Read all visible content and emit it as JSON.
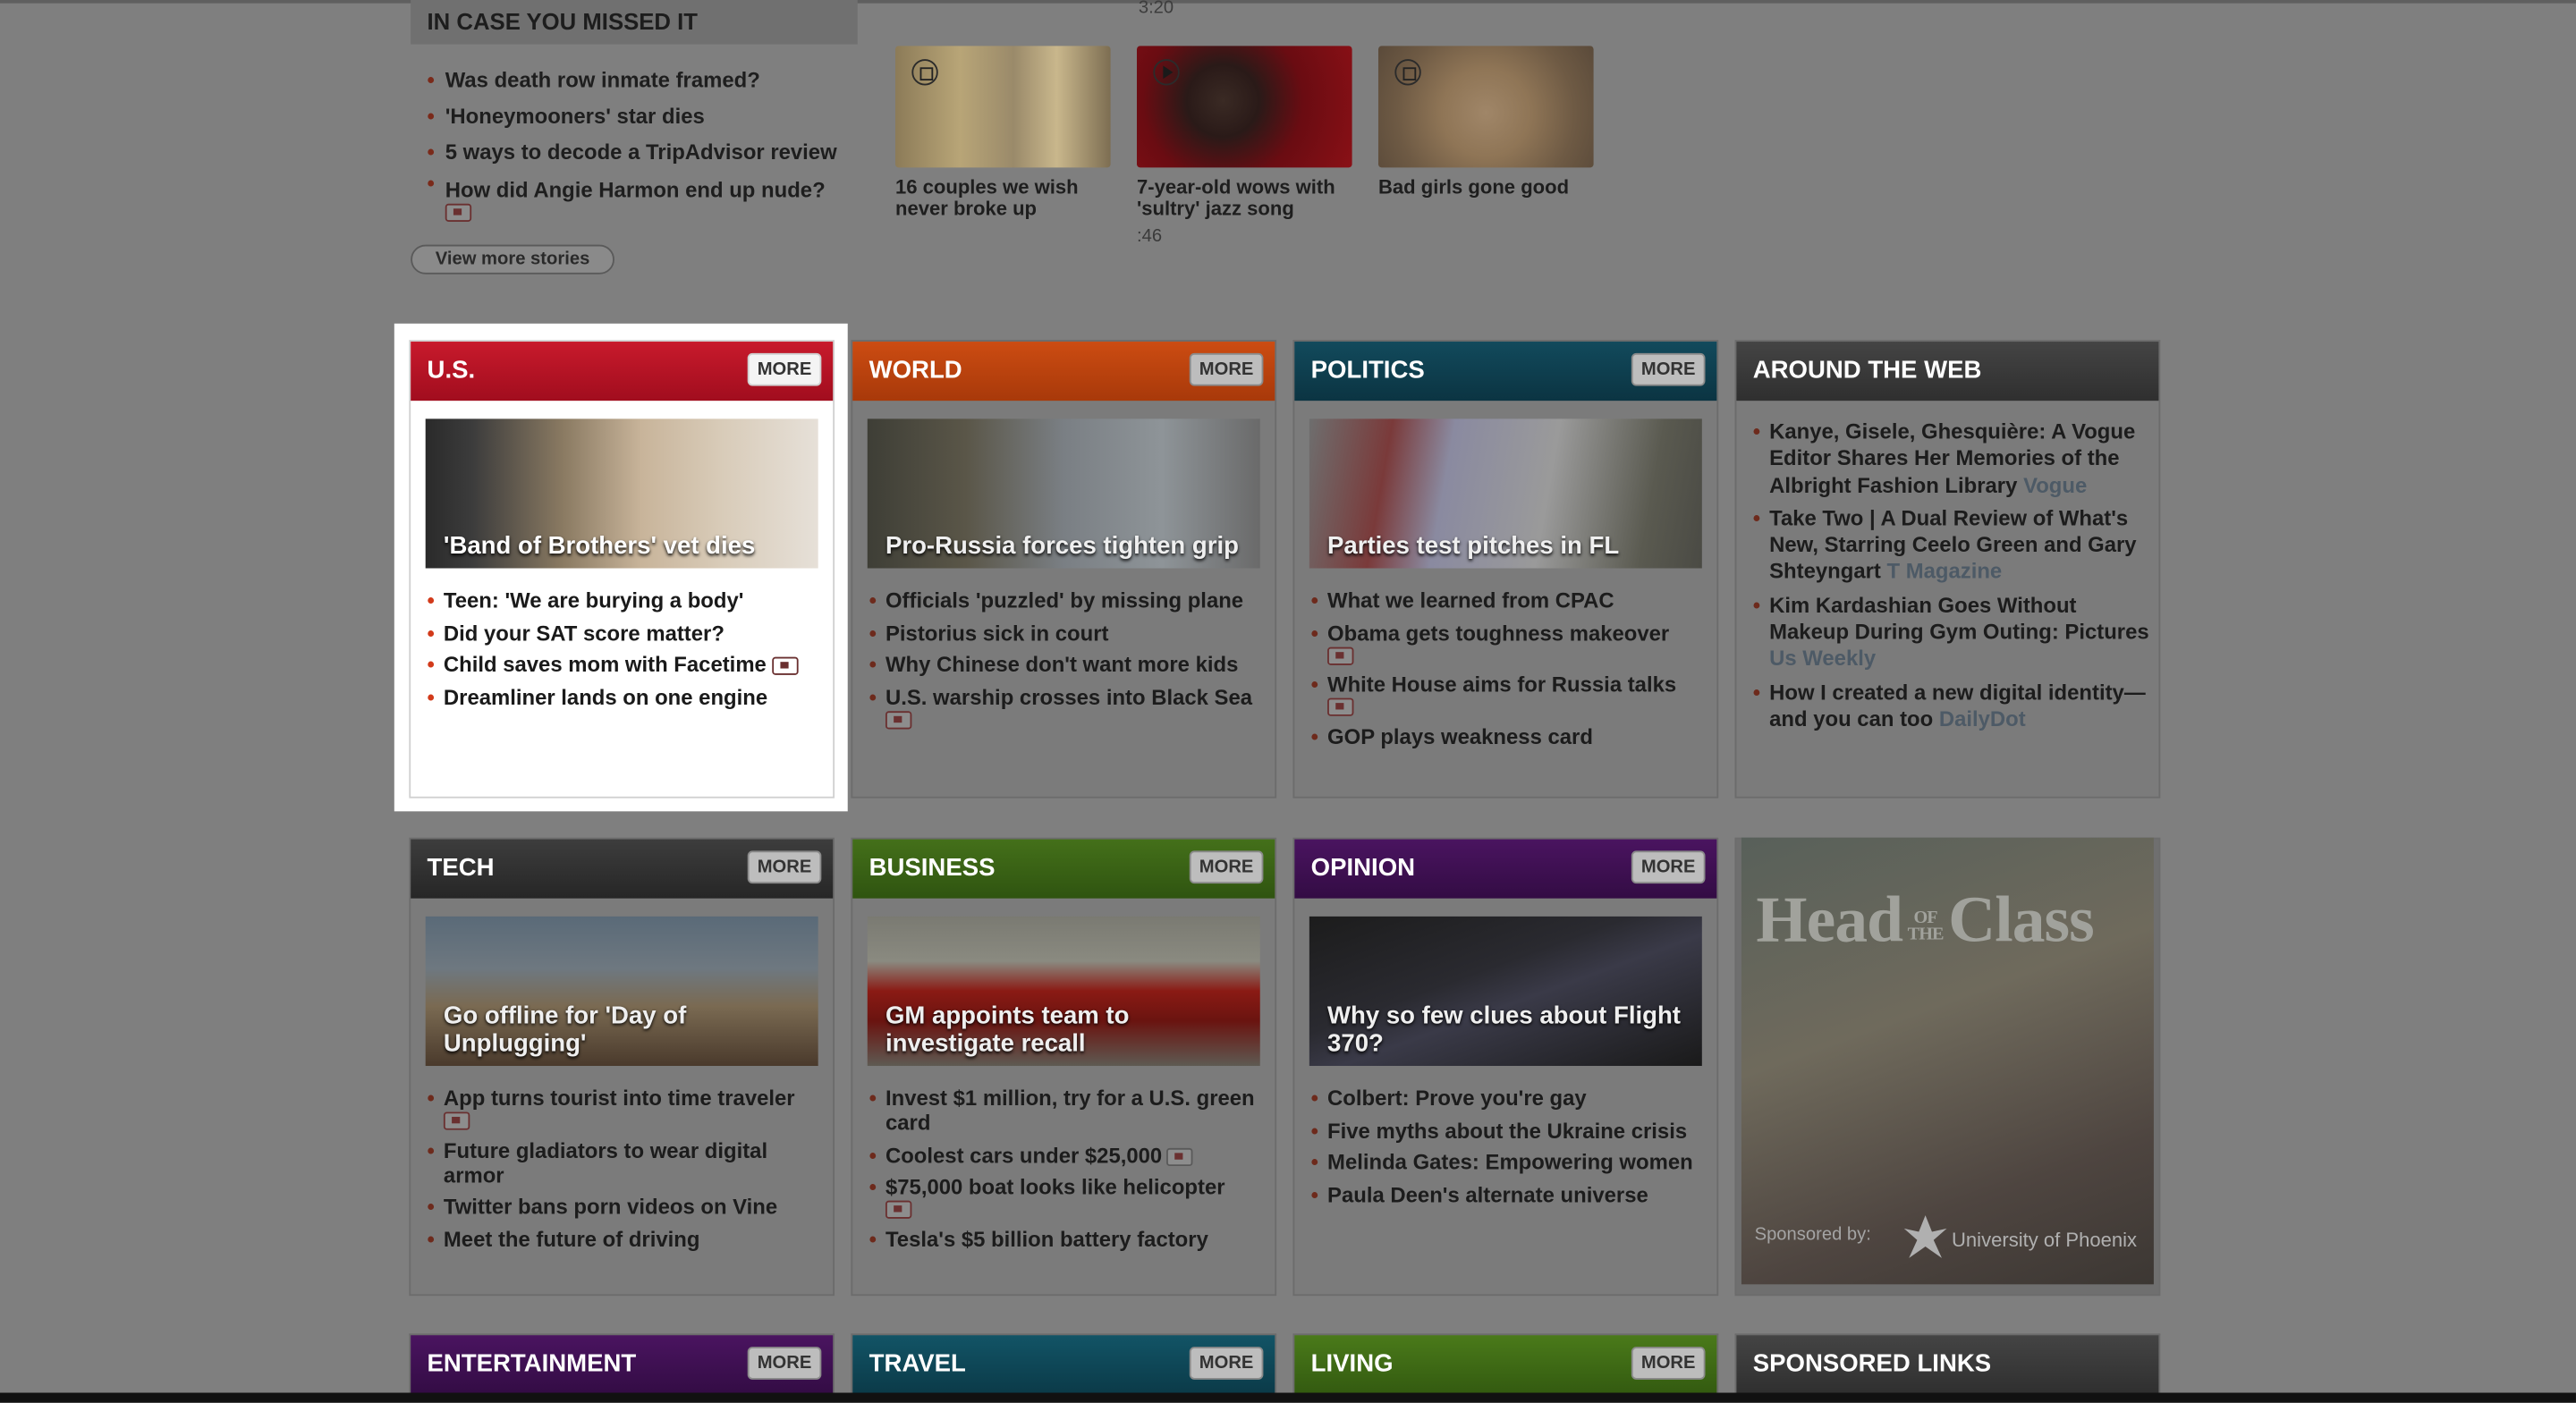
{
  "colors": {
    "us": "#b40f22",
    "world": "#c1440c",
    "politics": "#0f4050",
    "around_web": "#3a3a3a",
    "tech": "#333333",
    "business": "#3a5f12",
    "opinion": "#3d1250",
    "entertainment": "#3d1250",
    "travel": "#0f4656",
    "living": "#3e6512",
    "sponsored": "#3a3a3a"
  },
  "icymi": {
    "title": "IN CASE YOU MISSED IT",
    "items": [
      {
        "text": "Was death row inmate framed?"
      },
      {
        "text": "'Honeymooners' star dies"
      },
      {
        "text": "5 ways to decode a TripAdvisor review"
      },
      {
        "text": "How did Angie Harmon end up nude?",
        "icon": "video-icon"
      }
    ],
    "view_more": "View more stories",
    "top_time": "3:20",
    "thumbs": [
      {
        "caption": "16 couples we wish never broke up",
        "icon": "gallery-icon"
      },
      {
        "caption": "7-year-old wows with 'sultry' jazz song",
        "icon": "play-icon",
        "time": ":46"
      },
      {
        "caption": "Bad girls gone good",
        "icon": "gallery-icon"
      }
    ]
  },
  "more_label": "MORE",
  "sections": {
    "us": {
      "title": "U.S.",
      "image_caption": "'Band of Brothers' vet dies",
      "items": [
        "Teen: 'We are burying a body'",
        "Did your SAT score matter?",
        "Child saves mom with Facetime",
        "Dreamliner lands on one engine"
      ]
    },
    "world": {
      "title": "WORLD",
      "image_caption": "Pro-Russia forces tighten grip",
      "items": [
        "Officials 'puzzled' by missing plane",
        "Pistorius sick in court",
        "Why Chinese don't want more kids",
        "U.S. warship crosses into Black Sea"
      ]
    },
    "politics": {
      "title": "POLITICS",
      "image_caption": "Parties test pitches in FL",
      "items": [
        "What we learned from CPAC",
        "Obama gets toughness makeover",
        "White House aims for Russia talks",
        "GOP plays weakness card"
      ]
    },
    "around_web": {
      "title": "AROUND THE WEB",
      "items": [
        {
          "text": "Kanye, Gisele, Ghesquière: A Vogue Editor Shares Her Memories of the Albright Fashion Library",
          "source": "Vogue"
        },
        {
          "text": "Take Two | A Dual Review of What's New, Starring Ceelo Green and Gary Shteyngart",
          "source": "T Magazine"
        },
        {
          "text": "Kim Kardashian Goes Without Makeup During Gym Outing: Pictures",
          "source": "Us Weekly"
        },
        {
          "text": "How I created a new digital identity—and you can too",
          "source": "DailyDot"
        }
      ]
    },
    "tech": {
      "title": "TECH",
      "image_caption": "Go offline for 'Day of Unplugging'",
      "items": [
        "App turns tourist into time traveler",
        "Future gladiators to wear digital armor",
        "Twitter bans porn videos on Vine",
        "Meet the future of driving"
      ]
    },
    "business": {
      "title": "BUSINESS",
      "image_caption": "GM appoints team to investigate recall",
      "items": [
        "Invest $1 million, try for a U.S. green card",
        "Coolest cars under $25,000",
        "$75,000 boat looks like helicopter",
        "Tesla's $5 billion battery factory"
      ]
    },
    "opinion": {
      "title": "OPINION",
      "image_caption": "Why so few clues about Flight 370?",
      "items": [
        "Colbert: Prove you're gay",
        "Five myths about the Ukraine crisis",
        "Melinda Gates: Empowering women",
        "Paula Deen's alternate universe"
      ]
    },
    "entertainment": {
      "title": "ENTERTAINMENT"
    },
    "travel": {
      "title": "TRAVEL"
    },
    "living": {
      "title": "LIVING"
    },
    "sponsored": {
      "title": "SPONSORED LINKS"
    }
  },
  "ad": {
    "title_a": "Head",
    "title_of": "OF",
    "title_the": "THE",
    "title_b": "Class",
    "sponsor_label": "Sponsored by:",
    "sponsor_name": "University of Phoenix"
  }
}
